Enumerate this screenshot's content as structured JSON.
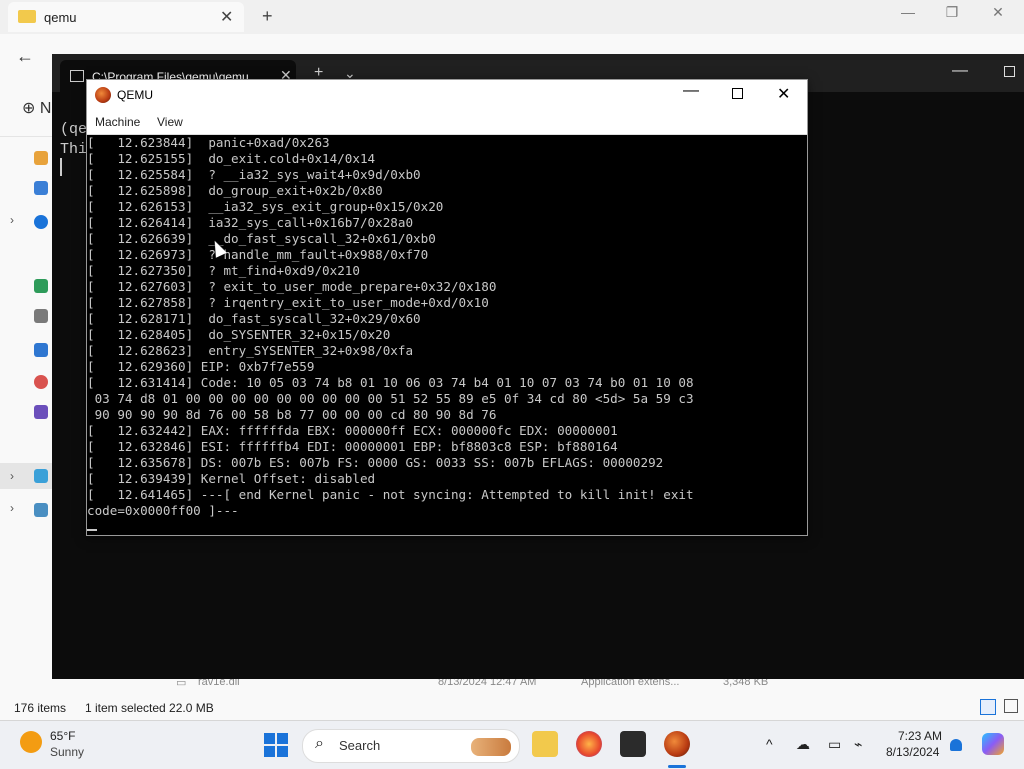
{
  "explorer": {
    "tab_title": "qemu",
    "tab_close": "✕",
    "new_tab": "+",
    "new_label": "N",
    "status": {
      "items": "176 items",
      "selected": "1 item selected  22.0 MB"
    },
    "file_row": {
      "name": "rav1e.dll",
      "date": "8/13/2024 12:47 AM",
      "type": "Application extens...",
      "size": "3,348 KB"
    }
  },
  "terminal": {
    "tab_title": "C:\\Program Files\\qemu\\qemu",
    "tab_close": "✕",
    "new_tab": "+",
    "dropdown": "⌄",
    "text": "(qe\nThi"
  },
  "qemu": {
    "title": "QEMU",
    "menu": {
      "machine": "Machine",
      "view": "View"
    },
    "console_lines": [
      "[   12.623844]  panic+0xad/0x263",
      "[   12.625155]  do_exit.cold+0x14/0x14",
      "[   12.625584]  ? __ia32_sys_wait4+0x9d/0xb0",
      "[   12.625898]  do_group_exit+0x2b/0x80",
      "[   12.626153]  __ia32_sys_exit_group+0x15/0x20",
      "[   12.626414]  ia32_sys_call+0x16b7/0x28a0",
      "[   12.626639]  __do_fast_syscall_32+0x61/0xb0",
      "[   12.626973]  ? handle_mm_fault+0x988/0xf70",
      "[   12.627350]  ? mt_find+0xd9/0x210",
      "[   12.627603]  ? exit_to_user_mode_prepare+0x32/0x180",
      "[   12.627858]  ? irqentry_exit_to_user_mode+0xd/0x10",
      "[   12.628171]  do_fast_syscall_32+0x29/0x60",
      "[   12.628405]  do_SYSENTER_32+0x15/0x20",
      "[   12.628623]  entry_SYSENTER_32+0x98/0xfa",
      "[   12.629360] EIP: 0xb7f7e559",
      "[   12.631414] Code: 10 05 03 74 b8 01 10 06 03 74 b4 01 10 07 03 74 b0 01 10 08",
      " 03 74 d8 01 00 00 00 00 00 00 00 00 00 51 52 55 89 e5 0f 34 cd 80 <5d> 5a 59 c3",
      " 90 90 90 90 8d 76 00 58 b8 77 00 00 00 cd 80 90 8d 76",
      "[   12.632442] EAX: ffffffda EBX: 000000ff ECX: 000000fc EDX: 00000001",
      "[   12.632846] ESI: ffffffb4 EDI: 00000001 EBP: bf8803c8 ESP: bf880164",
      "[   12.635678] DS: 007b ES: 007b FS: 0000 GS: 0033 SS: 007b EFLAGS: 00000292",
      "[   12.639439] Kernel Offset: disabled",
      "[   12.641465] ---[ end Kernel panic - not syncing: Attempted to kill init! exit",
      "code=0x0000ff00 ]---"
    ]
  },
  "taskbar": {
    "weather_temp": "65°F",
    "weather_desc": "Sunny",
    "search_label": "Search",
    "time": "7:23 AM",
    "date": "8/13/2024",
    "tray_chevron": "^"
  },
  "colors": {
    "accent": "#1a73d9",
    "terminal_bg": "#0c0c0c",
    "console_text": "#c8c8c8"
  }
}
